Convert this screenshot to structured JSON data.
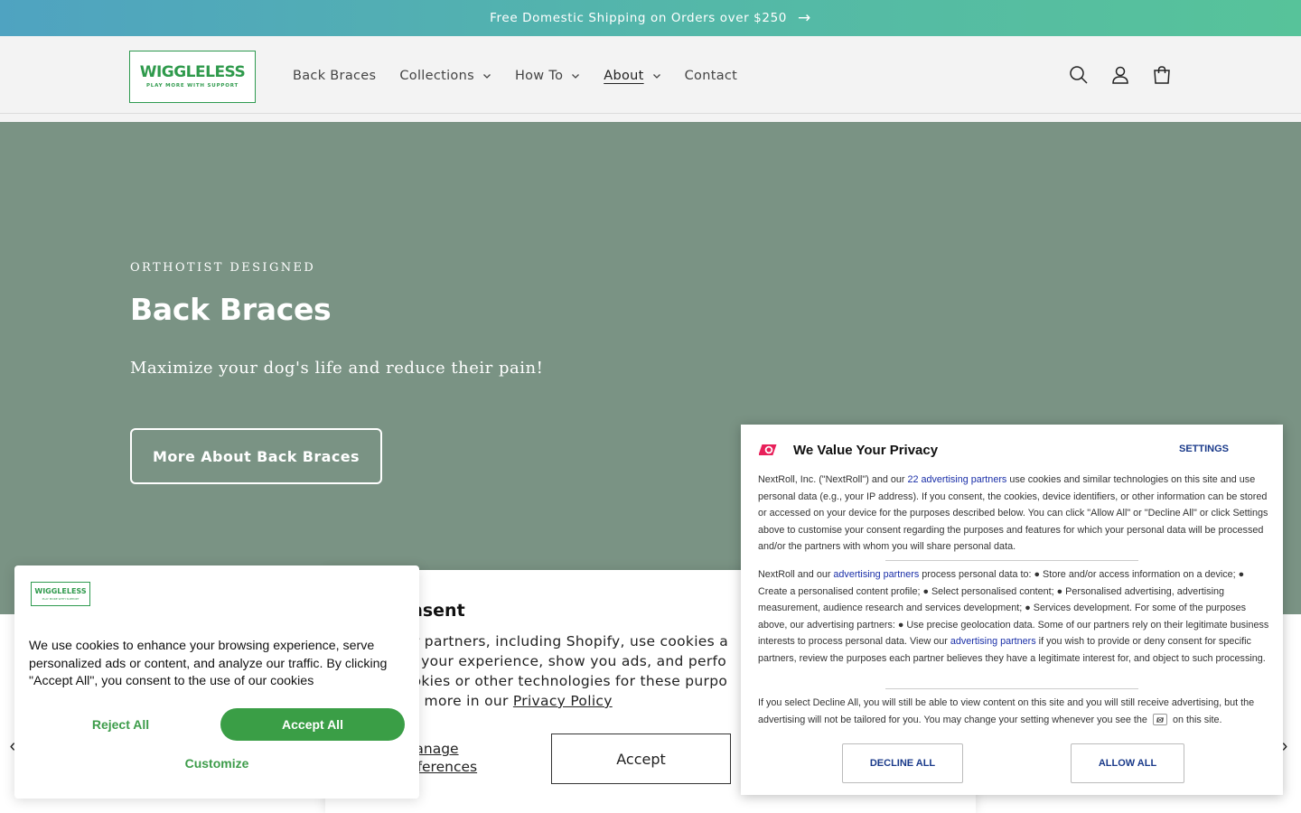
{
  "announcement": {
    "text": "Free Domestic Shipping on Orders over $250",
    "arrow": "→"
  },
  "logo": {
    "name": "WIGGLELESS",
    "tagline": "PLAY MORE WITH SUPPORT"
  },
  "nav": [
    {
      "label": "Back Braces",
      "has_dropdown": false
    },
    {
      "label": "Collections",
      "has_dropdown": true
    },
    {
      "label": "How To",
      "has_dropdown": true
    },
    {
      "label": "About",
      "has_dropdown": true,
      "active": true
    },
    {
      "label": "Contact",
      "has_dropdown": false
    }
  ],
  "header_icons": [
    "search-icon",
    "account-icon",
    "cart-icon"
  ],
  "hero": {
    "eyebrow": "ORTHOTIST DESIGNED",
    "title": "Back Braces",
    "subtitle": "Maximize your dog's life and reduce their pain!",
    "button": "More About Back Braces",
    "background": "#7a9384"
  },
  "carousel": {
    "prev": "‹",
    "next": "›"
  },
  "shopify_consent": {
    "title": "consent",
    "body": "our partners, including Shopify, use cookies a… ize your experience, show you ads, and perfo… cookies or other technologies for these purpo… arn more in our",
    "body_lines": [
      "our partners, including Shopify, use cookies a",
      "ize your experience, show you ads, and perfo",
      "cookies or other technologies for these purpo",
      "arn more in our "
    ],
    "privacy_link": "Privacy Policy",
    "manage": "Manage\nreferences",
    "manage_line1": "Manage",
    "manage_line2": "references",
    "accept": "Accept"
  },
  "cookie_popup": {
    "logo_text": "WIGGLELESS",
    "logo_tag": "PLAY MORE WITH SUPPORT",
    "text": "We use cookies to enhance your browsing experience, serve personalized ads or content, and analyze our traffic. By clicking \"Accept All\", you consent to the use of our cookies",
    "reject": "Reject All",
    "accept": "Accept All",
    "customize": "Customize",
    "accent": "#3a9e46"
  },
  "nextroll": {
    "title": "We Value Your Privacy",
    "settings": "SETTINGS",
    "p1_a": "NextRoll, Inc. (\"NextRoll\") and our ",
    "p1_link": "22 advertising partners",
    "p1_b": " use cookies and similar technologies on this site and use personal data (e.g., your IP address). If you consent, the cookies, device identifiers, or other information can be stored or accessed on your device for the purposes described below. You can click \"Allow All\" or \"Decline All\" or click Settings above to customise your consent regarding the purposes and features for which your personal data will be processed and/or the partners with whom you will share personal data.",
    "p2_a": "NextRoll and our ",
    "p2_link1": "advertising partners",
    "p2_b": " process personal data to: ● Store and/or access information on a device; ● Create a personalised content profile; ● Select personalised content; ● Personalised advertising, advertising measurement, audience research and services development; ● Services development. For some of the purposes above, our advertising partners: ● Use precise geolocation data. Some of our partners rely on their legitimate business interests to process personal data. View our ",
    "p2_link2": "advertising partners",
    "p2_c": " if you wish to provide or deny consent for specific partners, review the purposes each partner believes they have a legitimate interest for, and object to such processing.",
    "p3_a": "If you select Decline All, you will still be able to view content on this site and you will still receive advertising, but the advertising will not be tailored for you. You may change your setting whenever you see the",
    "p3_b": "on this site.",
    "decline": "DECLINE ALL",
    "allow": "ALLOW ALL",
    "brand_color": "#e8205a",
    "link_color": "#1a2fa8"
  }
}
